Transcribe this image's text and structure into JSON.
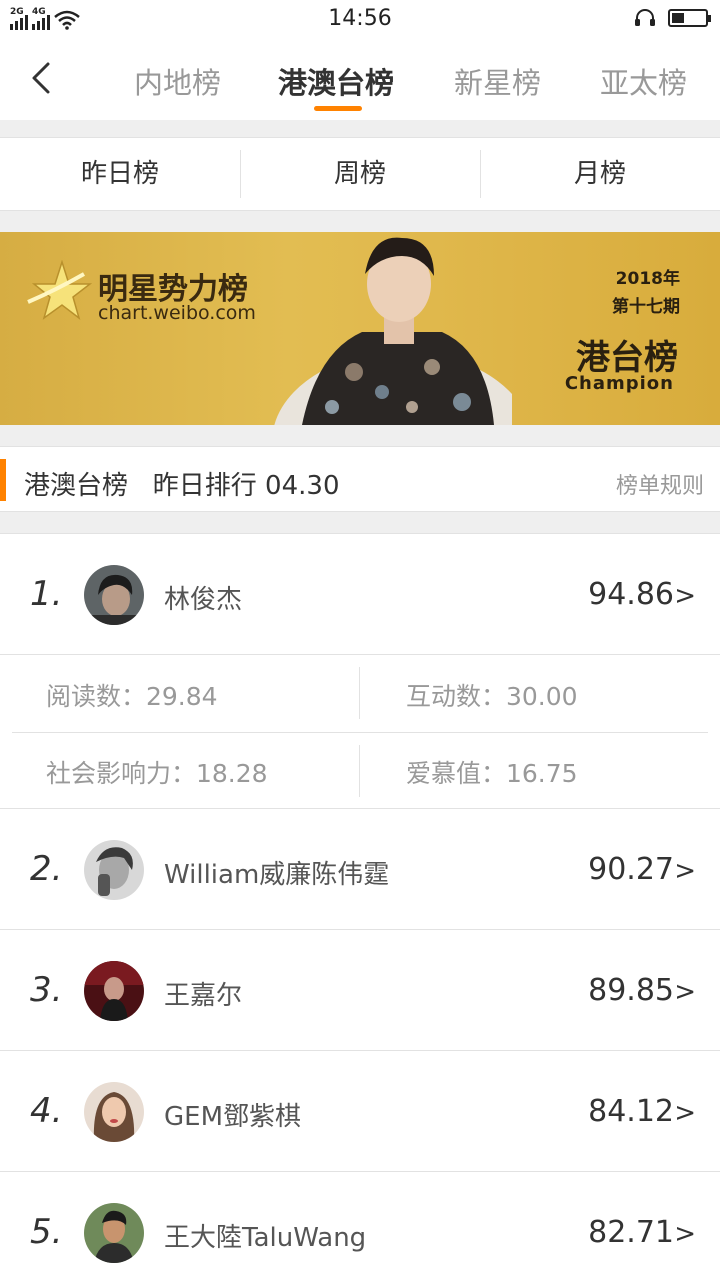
{
  "status": {
    "time": "14:56",
    "sim1": "2G",
    "sim2": "4G",
    "battery_level": 0.35
  },
  "nav": {
    "tabs": [
      {
        "label": "内地榜"
      },
      {
        "label": "港澳台榜"
      },
      {
        "label": "新星榜"
      },
      {
        "label": "亚太榜"
      }
    ],
    "active_tab": 1
  },
  "subtabs": [
    {
      "label": "昨日榜"
    },
    {
      "label": "周榜"
    },
    {
      "label": "月榜"
    }
  ],
  "banner": {
    "brand": "明星势力榜",
    "url": "chart.weibo.com",
    "year": "2018年",
    "issue": "第十七期",
    "headline": "港台榜",
    "subline": "Champion"
  },
  "section": {
    "title": "港澳台榜   昨日排行 04.30",
    "rules_link": "榜单规则"
  },
  "entries": [
    {
      "rank": "1.",
      "name": "林俊杰",
      "score": "94.86"
    },
    {
      "rank": "2.",
      "name": "William威廉陈伟霆",
      "score": "90.27"
    },
    {
      "rank": "3.",
      "name": "王嘉尔",
      "score": "89.85"
    },
    {
      "rank": "4.",
      "name": "GEM鄧紫棋",
      "score": "84.12"
    },
    {
      "rank": "5.",
      "name": "王大陸TaluWang",
      "score": "82.71"
    }
  ],
  "detail": {
    "reads": "阅读数：29.84",
    "interactions": "互动数：30.00",
    "social": "社会影响力：18.28",
    "love": "爱慕值：16.75"
  },
  "chevron": ">"
}
